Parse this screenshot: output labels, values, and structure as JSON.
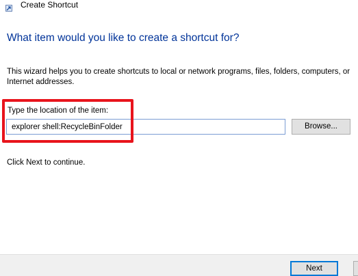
{
  "window": {
    "title": "Create Shortcut",
    "icon": "shortcut-wizard-icon"
  },
  "wizard": {
    "heading": "What item would you like to create a shortcut for?",
    "description": "This wizard helps you to create shortcuts to local or network programs, files, folders, computers, or Internet addresses.",
    "location_label": "Type the location of the item:",
    "location_value": "explorer shell:RecycleBinFolder",
    "browse_label": "Browse...",
    "continue_text": "Click Next to continue."
  },
  "footer": {
    "next_label": "Next"
  },
  "colors": {
    "heading": "#003399",
    "highlight": "#e8141c",
    "footer_bg": "#f0f0f0",
    "focus_border": "#0078d7"
  }
}
